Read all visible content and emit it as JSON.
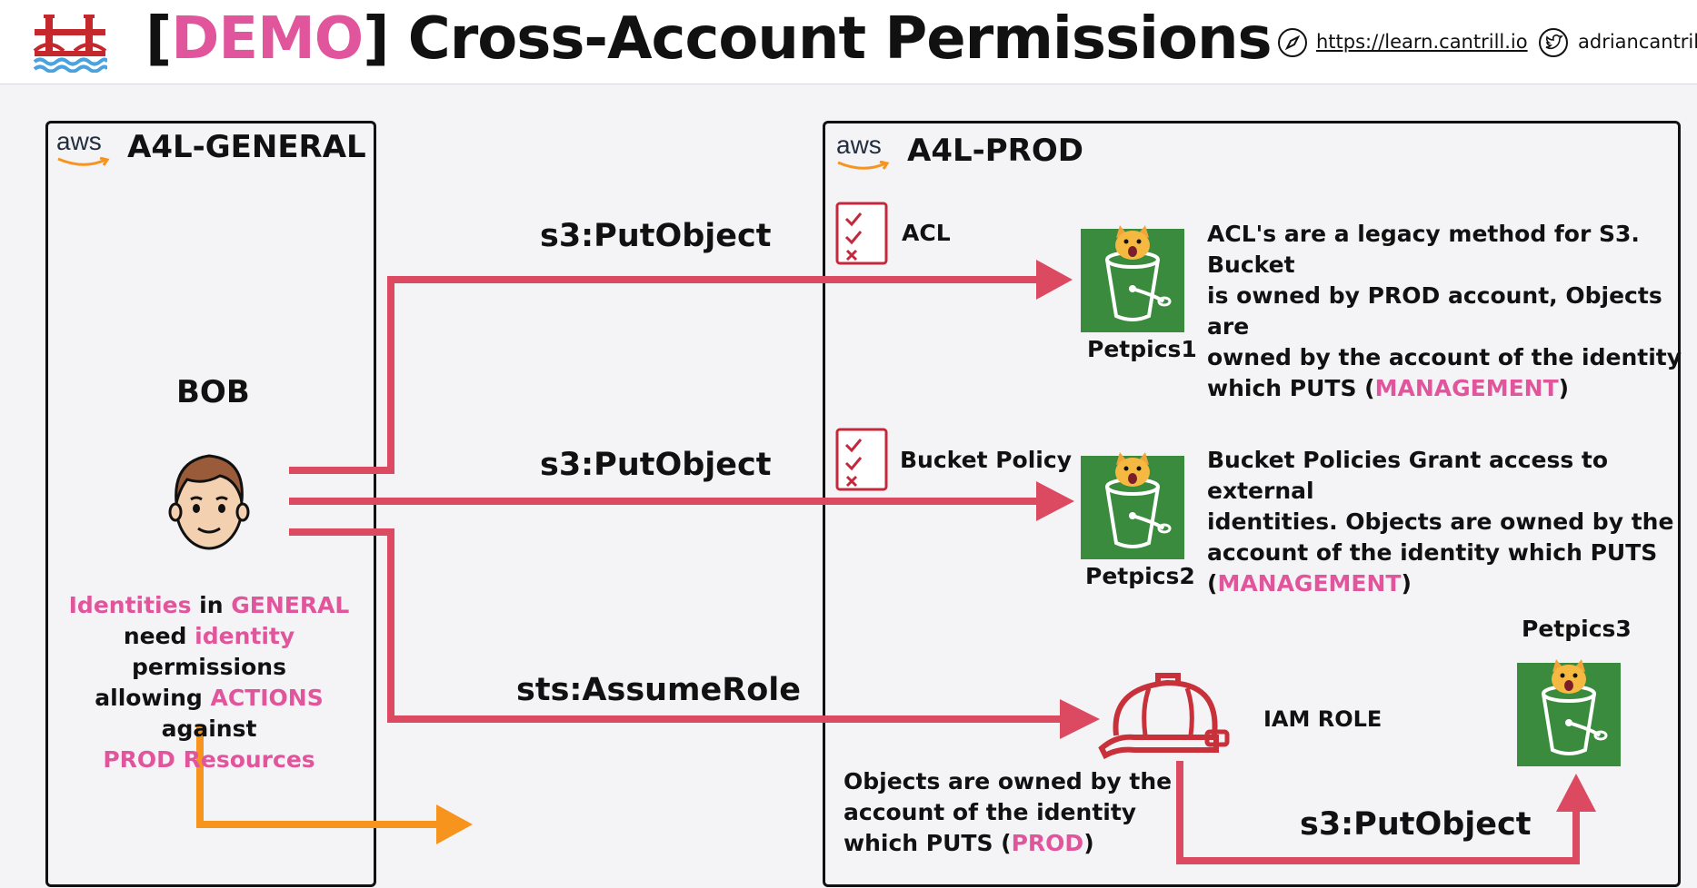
{
  "header": {
    "title_open": "[",
    "title_demo": "DEMO",
    "title_close": "]",
    "title_rest": " Cross-Account Permissions",
    "url": "https://learn.cantrill.io",
    "twitter": "adriancantrill"
  },
  "accounts": {
    "general": {
      "name": "A4L-GENERAL",
      "logo_text": "aws"
    },
    "prod": {
      "name": "A4L-PROD",
      "logo_text": "aws"
    }
  },
  "user": {
    "name": "BOB",
    "note_lines": [
      [
        {
          "t": "Identities",
          "pink": true
        },
        {
          "t": " in ",
          "pink": false
        },
        {
          "t": "GENERAL",
          "pink": true
        }
      ],
      [
        {
          "t": "need ",
          "pink": false
        },
        {
          "t": "identity",
          "pink": true
        },
        {
          "t": " permissions",
          "pink": false
        }
      ],
      [
        {
          "t": "allowing ",
          "pink": false
        },
        {
          "t": "ACTIONS",
          "pink": true
        },
        {
          "t": " against",
          "pink": false
        }
      ],
      [
        {
          "t": "PROD Resources",
          "pink": true
        }
      ]
    ]
  },
  "arrows": {
    "top_action": "s3:PutObject",
    "mid_action": "s3:PutObject",
    "bottom_action": "sts:AssumeRole",
    "role_action": "s3:PutObject"
  },
  "policies": {
    "acl": "ACL",
    "bucket_policy": "Bucket Policy"
  },
  "buckets": {
    "b1": "Petpics1",
    "b2": "Petpics2",
    "b3": "Petpics3"
  },
  "role": {
    "label": "IAM ROLE"
  },
  "notes": {
    "acl_note": [
      [
        {
          "t": "ACL's are a legacy method for S3. Bucket",
          "pink": false
        }
      ],
      [
        {
          "t": "is owned by PROD account, Objects are",
          "pink": false
        }
      ],
      [
        {
          "t": "owned by the account of the identity",
          "pink": false
        }
      ],
      [
        {
          "t": "which PUTS (",
          "pink": false
        },
        {
          "t": "MANAGEMENT",
          "pink": true
        },
        {
          "t": ")",
          "pink": false
        }
      ]
    ],
    "policy_note": [
      [
        {
          "t": "Bucket Policies Grant access to external",
          "pink": false
        }
      ],
      [
        {
          "t": "identities. Objects are owned by the",
          "pink": false
        }
      ],
      [
        {
          "t": "account of the identity which PUTS",
          "pink": false
        }
      ],
      [
        {
          "t": "(",
          "pink": false
        },
        {
          "t": "MANAGEMENT",
          "pink": true
        },
        {
          "t": ")",
          "pink": false
        }
      ]
    ],
    "role_note": [
      [
        {
          "t": "Objects are owned by the",
          "pink": false
        }
      ],
      [
        {
          "t": "account of the identity",
          "pink": false
        }
      ],
      [
        {
          "t": "which PUTS (",
          "pink": false
        },
        {
          "t": "PROD",
          "pink": true
        },
        {
          "t": ")",
          "pink": false
        }
      ]
    ]
  },
  "colors": {
    "accent": "#e0559c",
    "arrow": "#dc4a62",
    "orange": "#f7941d",
    "bucket_bg": "#3b8b3e",
    "helmet": "#c8303a"
  }
}
